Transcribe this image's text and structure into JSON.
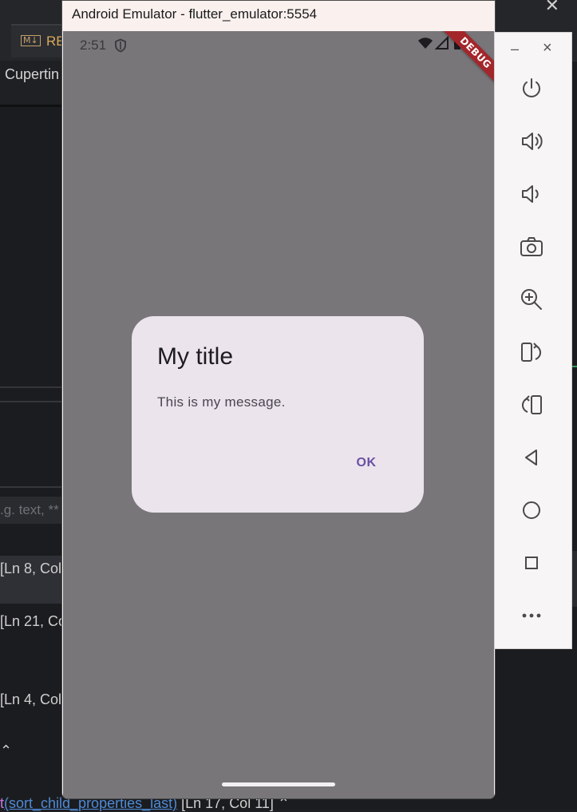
{
  "ide": {
    "tab_badge": "M↓",
    "tab_label": "RE",
    "sub_label": "Cupertin",
    "search_placeholder": ".g. text, **",
    "rows": [
      "[Ln 8, Col",
      "[Ln 21, Co",
      "[Ln 4, Col"
    ],
    "caret": "^",
    "bottom_prefix": "t",
    "bottom_fn": "(sort_child_properties_last)",
    "bottom_pos": "[Ln 17, Col 11]",
    "bottom_caret": "^"
  },
  "window": {
    "title": "Android Emulator - flutter_emulator:5554"
  },
  "status_bar": {
    "time": "2:51"
  },
  "debug_banner": "DEBUG",
  "dialog": {
    "title": "My title",
    "message": "This is my message.",
    "ok_label": "OK"
  },
  "colors": {
    "scrim": "#79767a",
    "dialog_bg": "#ebe4ec",
    "accent": "#6750a4",
    "debug_banner": "#a3262a"
  },
  "toolbar": {
    "minimize": "–",
    "close": "×",
    "icons": [
      "power-icon",
      "volume-up-icon",
      "volume-down-icon",
      "camera-icon",
      "zoom-icon",
      "rotate-left-icon",
      "rotate-right-icon",
      "back-icon",
      "home-icon",
      "overview-icon",
      "more-icon"
    ]
  }
}
